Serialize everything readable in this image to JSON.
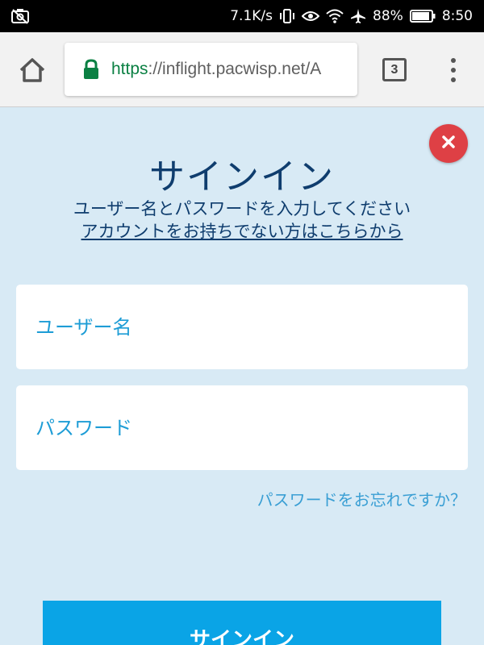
{
  "status_bar": {
    "net_speed": "7.1K/s",
    "battery": "88%",
    "time": "8:50",
    "icons": [
      "no-photo-icon",
      "vibrate-icon",
      "eye-icon",
      "wifi-icon",
      "airplane-icon",
      "battery-icon"
    ]
  },
  "browser": {
    "url_scheme": "https",
    "url_rest": "://inflight.pacwisp.net/A",
    "tab_count": "3",
    "icons": [
      "home-icon",
      "lock-icon",
      "tabs-icon",
      "menu-icon"
    ]
  },
  "login": {
    "title": "サインイン",
    "subtitle": "ユーザー名とパスワードを入力してください",
    "register_link": "アカウントをお持ちでない方はこちらから",
    "username_placeholder": "ユーザー名",
    "password_placeholder": "パスワード",
    "forgot_link": "パスワードをお忘れですか？",
    "submit_label": "サインイン"
  },
  "colors": {
    "background": "#d8eaf5",
    "title": "#0f3d6e",
    "placeholder": "#1e9dd6",
    "button": "#0aa4e6",
    "close": "#de4045",
    "secure": "#0b8043"
  }
}
